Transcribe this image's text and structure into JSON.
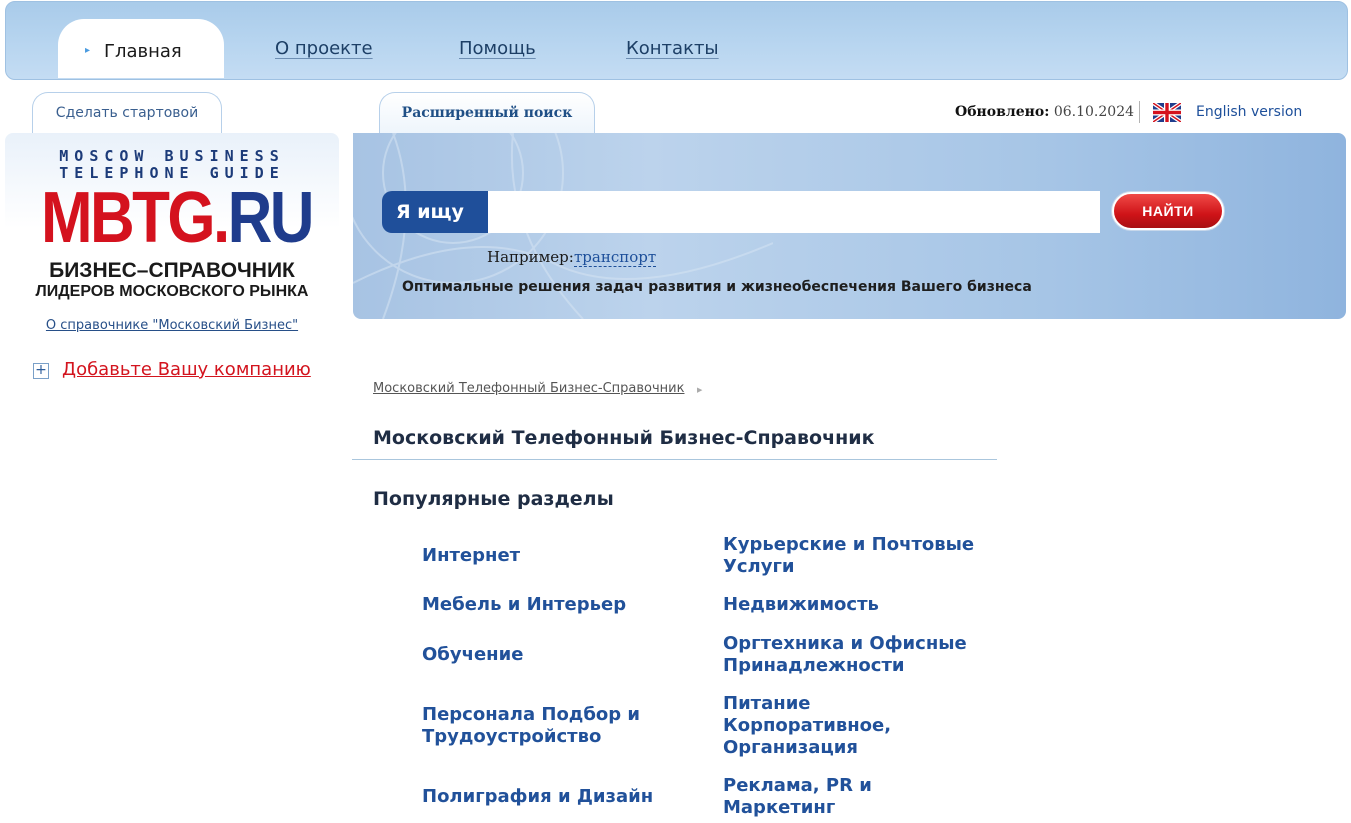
{
  "nav": {
    "home": "Главная",
    "about": "О проекте",
    "help": "Помощь",
    "contacts": "Контакты"
  },
  "subtabs": {
    "make_start": "Сделать стартовой",
    "advanced_search": "Расширенный поиск"
  },
  "header_info": {
    "updated_label": "Обновлено:",
    "updated_date": "06.10.2024",
    "english": "English version"
  },
  "logo": {
    "line1": "MOSCOW BUSINESS",
    "line2": "TELEPHONE GUIDE",
    "main_red": "MBTG.",
    "main_blue": "RU",
    "sub1": "БИЗНЕС–СПРАВОЧНИК",
    "sub2": "ЛИДЕРОВ МОСКОВСКОГО РЫНКА",
    "about_link": "О справочнике \"Московский Бизнес\""
  },
  "sidebar": {
    "add_company": "Добавьте Вашу компанию"
  },
  "search": {
    "label": "Я ищу",
    "value": "",
    "button": "НАЙТИ",
    "example_label": "Например:",
    "example_link": "транспорт",
    "tagline": "Оптимальные решения задач развития и жизнеобеспечения Вашего бизнеса"
  },
  "content": {
    "breadcrumb": "Московский Телефонный Бизнес-Справочник",
    "title": "Московский Телефонный Бизнес-Справочник",
    "popular_heading": "Популярные разделы",
    "categories_left": [
      "Интернет",
      "Мебель и Интерьер",
      "Обучение",
      "Персонала Подбор и Трудоустройство",
      "Полиграфия и Дизайн"
    ],
    "categories_right": [
      "Курьерские и Почтовые Услуги",
      "Недвижимость",
      "Оргтехника и Офисные Принадлежности",
      "Питание Корпоративное, Организация",
      "Реклама, PR и Маркетинг"
    ]
  },
  "colors": {
    "nav_bg": "#b9d6f0",
    "brand_red": "#d4121e",
    "brand_blue": "#1f3c8c",
    "link_blue": "#21519a"
  }
}
